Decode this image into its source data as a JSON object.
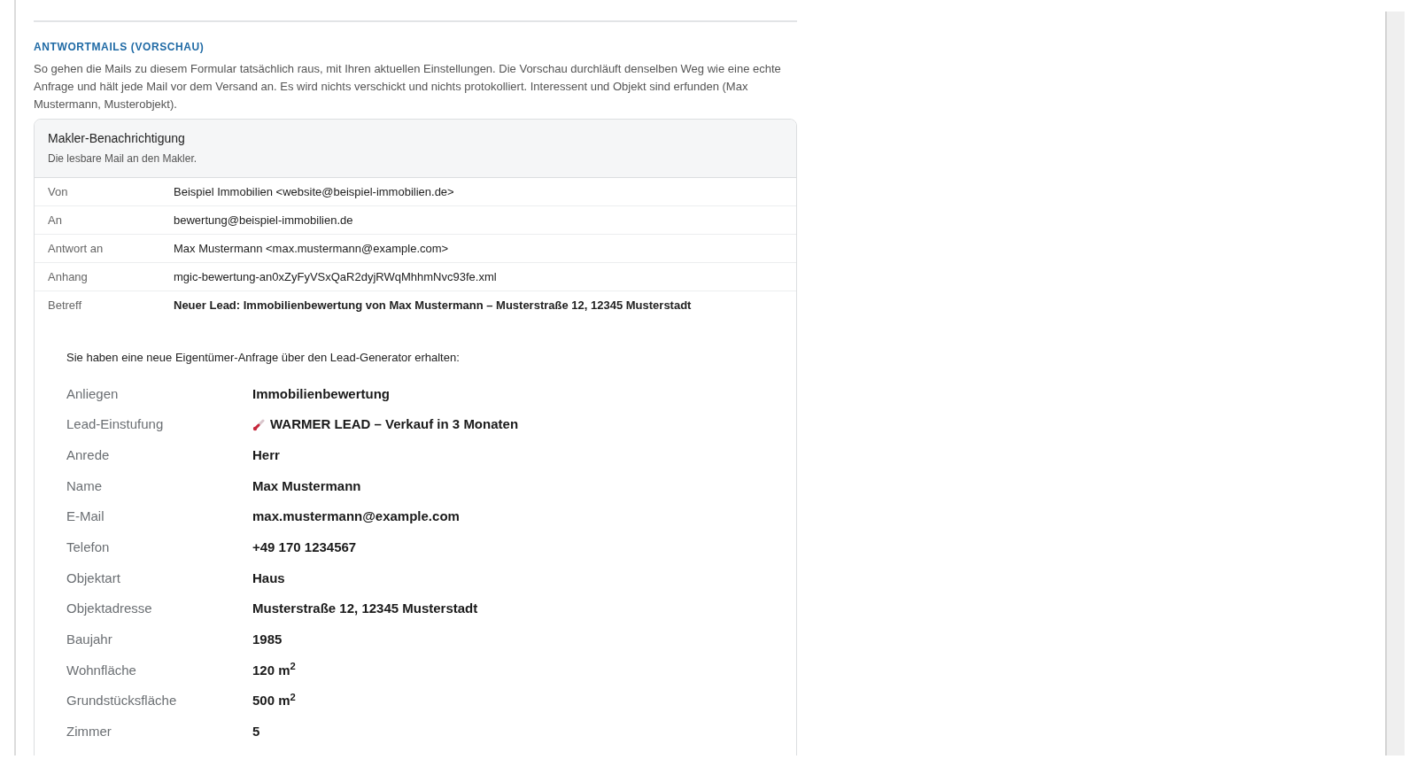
{
  "section": {
    "title": "ANTWORTMAILS (VORSCHAU)",
    "description": "So gehen die Mails zu diesem Formular tatsächlich raus, mit Ihren aktuellen Einstellungen. Die Vorschau durchläuft denselben Weg wie eine echte Anfrage und hält jede Mail vor dem Versand an. Es wird nichts verschickt und nichts protokolliert. Interessent und Objekt sind erfunden (Max Mustermann, Musterobjekt)."
  },
  "mail": {
    "title": "Makler-Benachrichtigung",
    "subtitle": "Die lesbare Mail an den Makler.",
    "headers": [
      {
        "label": "Von",
        "value": "Beispiel Immobilien <website@beispiel-immobilien.de>",
        "bold": false
      },
      {
        "label": "An",
        "value": "bewertung@beispiel-immobilien.de",
        "bold": false
      },
      {
        "label": "Antwort an",
        "value": "Max Mustermann <max.mustermann@example.com>",
        "bold": false
      },
      {
        "label": "Anhang",
        "value": "mgic-bewertung-an0xZyFyVSxQaR2dyjRWqMhhmNvc93fe.xml",
        "bold": false
      },
      {
        "label": "Betreff",
        "value": "Neuer Lead: Immobilienbewertung von Max Mustermann – Musterstraße 12, 12345 Musterstadt",
        "bold": true
      }
    ],
    "intro": "Sie haben eine neue Eigentümer-Anfrage über den Lead-Generator erhalten:",
    "fields": [
      {
        "label": "Anliegen",
        "value": "Immobilienbewertung"
      },
      {
        "label": "Lead-Einstufung",
        "value": "WARMER LEAD – Verkauf in 3 Monaten",
        "kind": "thermometer"
      },
      {
        "label": "Anrede",
        "value": "Herr"
      },
      {
        "label": "Name",
        "value": "Max Mustermann"
      },
      {
        "label": "E-Mail",
        "value": "max.mustermann@example.com"
      },
      {
        "label": "Telefon",
        "value": "+49 170 1234567"
      },
      {
        "label": "Objektart",
        "value": "Haus"
      },
      {
        "label": "Objektadresse",
        "value": "Musterstraße 12, 12345 Musterstadt"
      },
      {
        "label": "Baujahr",
        "value": "1985"
      },
      {
        "label": "Wohnfläche",
        "value": "120 m$^{2}$"
      },
      {
        "label": "Grundstücksfläche",
        "value": "500 m$^{2}$"
      },
      {
        "label": "Zimmer",
        "value": "5"
      }
    ]
  }
}
